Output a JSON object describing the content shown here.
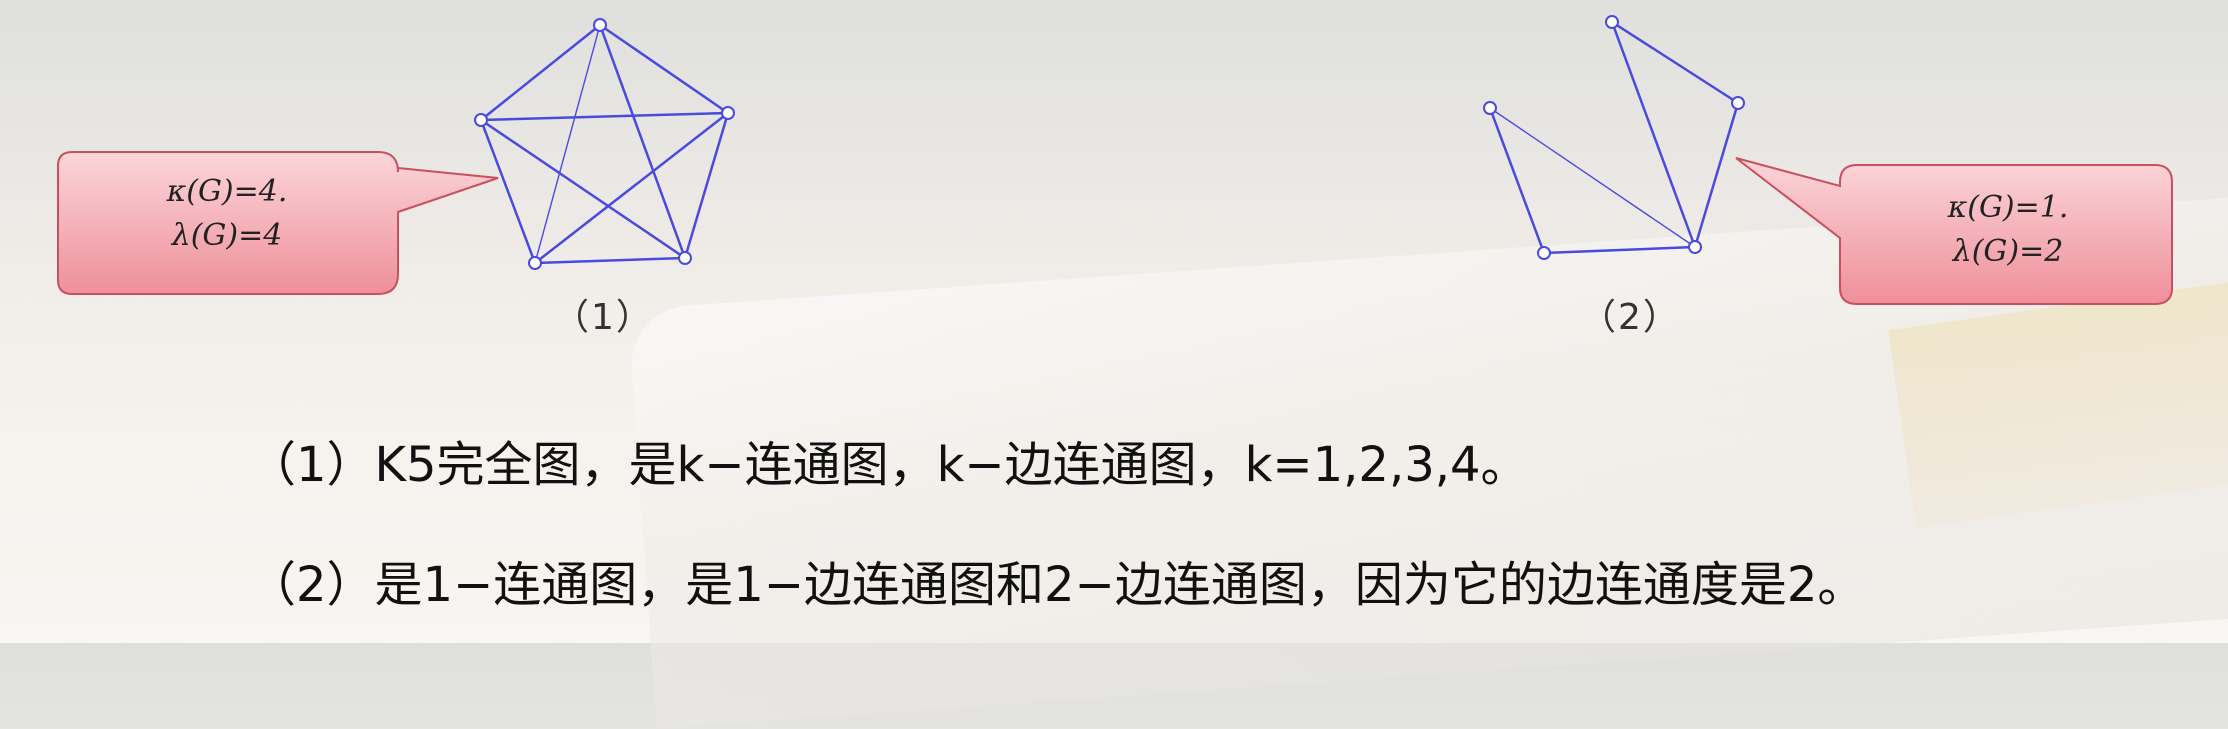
{
  "graph1": {
    "kappa_text": "κ(G)=4.",
    "lambda_text": "λ(G)=4",
    "label": "（1）"
  },
  "graph2": {
    "kappa_text": "κ(G)=1.",
    "lambda_text": "λ(G)=2",
    "label": "（2）"
  },
  "text": {
    "line1": "（1）K5完全图，是k−连通图，k−边连通图，k=1,2,3,4。",
    "line2": "（2）是1−连通图，是1−边连通图和2−边连通图，因为它的边连通度是2。"
  },
  "colors": {
    "edge": "#4a4adf",
    "callout_fill": "#f2a9b1",
    "callout_stroke": "#c8505f"
  }
}
